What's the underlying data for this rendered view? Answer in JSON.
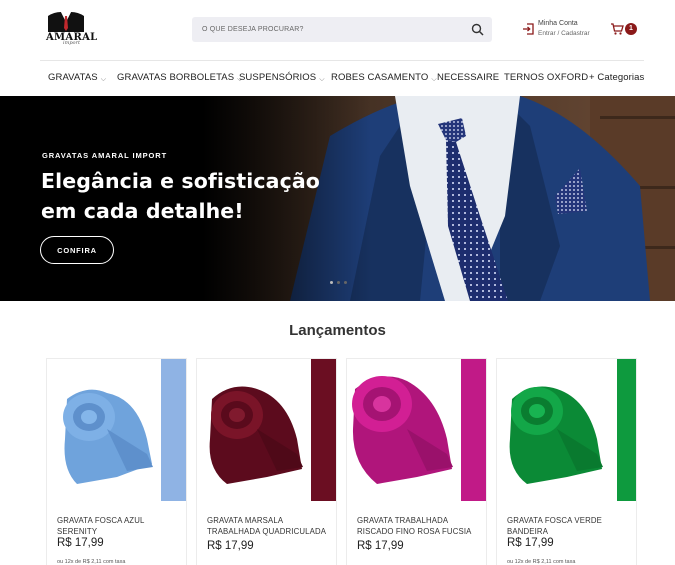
{
  "header": {
    "logo_text": "AMARAL",
    "logo_sub": "import",
    "search_placeholder": "O QUE DESEJA PROCURAR?",
    "account_title": "Minha Conta",
    "account_sub": "Entrar / Cadastrar",
    "cart_count": "1"
  },
  "nav": {
    "items": [
      {
        "label": "GRAVATAS",
        "chevron": true
      },
      {
        "label": "GRAVATAS BORBOLETAS",
        "chevron": true
      },
      {
        "label": "SUSPENSÓRIOS",
        "chevron": true
      },
      {
        "label": "ROBES CASAMENTO",
        "chevron": true
      },
      {
        "label": "NECESSAIRE",
        "chevron": false
      },
      {
        "label": "TERNOS OXFORD",
        "chevron": false
      },
      {
        "label": "+ Categorias",
        "chevron": false
      }
    ]
  },
  "hero": {
    "eyebrow": "GRAVATAS AMARAL IMPORT",
    "title": "Elegância e sofisticação em cada detalhe!",
    "cta": "CONFIRA",
    "slides": 3,
    "active_slide": 2
  },
  "section": {
    "title": "Lançamentos"
  },
  "products": [
    {
      "name": "GRAVATA FOSCA AZUL SERENITY",
      "price": "R$ 17,99",
      "color": "#6fa3dc",
      "subtext": "ou 12x de R$ 2,11 com taxa"
    },
    {
      "name": "GRAVATA MARSALA TRABALHADA QUADRICULADA",
      "price": "R$ 17,99",
      "color": "#6b0e22",
      "subtext": ""
    },
    {
      "name": "GRAVATA TRABALHADA RISCADO FINO ROSA FUCSIA",
      "price": "R$ 17,99",
      "color": "#c4198a",
      "subtext": ""
    },
    {
      "name": "GRAVATA FOSCA VERDE BANDEIRA",
      "price": "R$ 17,99",
      "color": "#0e9a3e",
      "subtext": "ou 12x de R$ 2,11 com taxa"
    }
  ],
  "colors": {
    "accent": "#8b1a1a",
    "search_bg": "#eeeef3"
  }
}
